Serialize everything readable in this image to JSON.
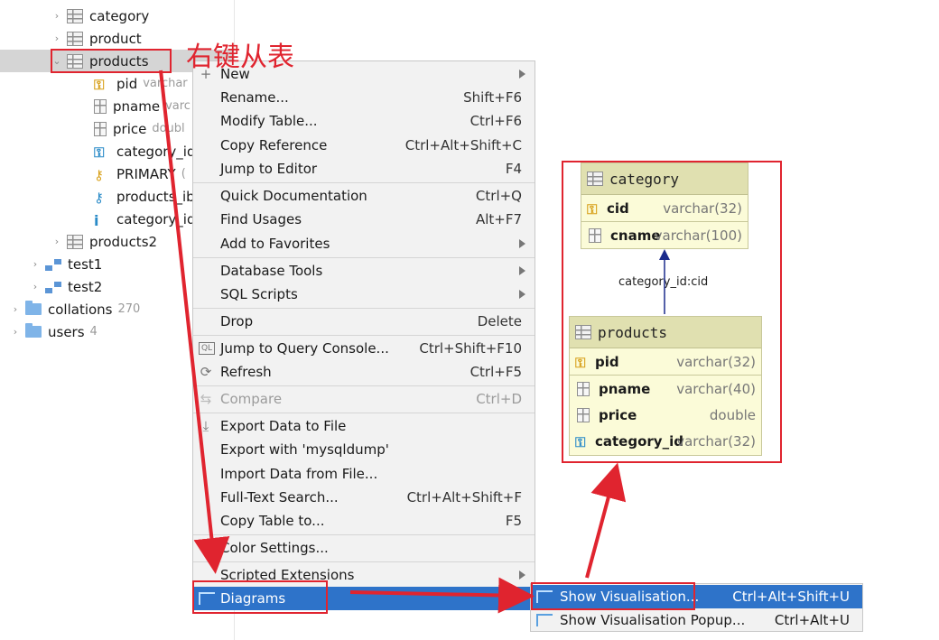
{
  "tree": {
    "items": [
      {
        "label": "category",
        "type": "table"
      },
      {
        "label": "product",
        "type": "table"
      },
      {
        "label": "products",
        "type": "table",
        "selected": true
      },
      {
        "label": "pid",
        "type": "column-pk",
        "detail": "varchar"
      },
      {
        "label": "pname",
        "type": "column",
        "detail": "varc"
      },
      {
        "label": "price",
        "type": "column",
        "detail": "doubl"
      },
      {
        "label": "category_id",
        "type": "column-fk",
        "detail": ""
      },
      {
        "label": "PRIMARY",
        "type": "key",
        "detail": "("
      },
      {
        "label": "products_ib",
        "type": "foreign-key",
        "detail": ""
      },
      {
        "label": "category_id",
        "type": "index",
        "detail": ""
      },
      {
        "label": "products2",
        "type": "table"
      },
      {
        "label": "test1",
        "type": "schema"
      },
      {
        "label": "test2",
        "type": "schema"
      },
      {
        "label": "collations",
        "type": "folder",
        "count": "270"
      },
      {
        "label": "users",
        "type": "folder",
        "count": "4"
      }
    ]
  },
  "annotation": {
    "text": "右键从表"
  },
  "menu": {
    "items": [
      {
        "label": "New",
        "shortcut": "",
        "submenu": true,
        "icon": "plus-icon"
      },
      {
        "label": "Rename...",
        "shortcut": "Shift+F6"
      },
      {
        "label": "Modify Table...",
        "shortcut": "Ctrl+F6"
      },
      {
        "label": "Copy Reference",
        "shortcut": "Ctrl+Alt+Shift+C"
      },
      {
        "label": "Jump to Editor",
        "shortcut": "F4"
      },
      {
        "label": "Quick Documentation",
        "shortcut": "Ctrl+Q"
      },
      {
        "label": "Find Usages",
        "shortcut": "Alt+F7"
      },
      {
        "label": "Add to Favorites",
        "shortcut": "",
        "submenu": true
      },
      {
        "label": "Database Tools",
        "shortcut": "",
        "submenu": true
      },
      {
        "label": "SQL Scripts",
        "shortcut": "",
        "submenu": true
      },
      {
        "label": "Drop",
        "shortcut": "Delete"
      },
      {
        "label": "Jump to Query Console...",
        "shortcut": "Ctrl+Shift+F10",
        "icon": "query-console-icon"
      },
      {
        "label": "Refresh",
        "shortcut": "Ctrl+F5",
        "icon": "refresh-icon"
      },
      {
        "label": "Compare",
        "shortcut": "Ctrl+D",
        "disabled": true,
        "icon": "compare-icon"
      },
      {
        "label": "Export Data to File",
        "shortcut": "",
        "icon": "export-icon"
      },
      {
        "label": "Export with 'mysqldump'",
        "shortcut": ""
      },
      {
        "label": "Import Data from File...",
        "shortcut": ""
      },
      {
        "label": "Full-Text Search...",
        "shortcut": "Ctrl+Alt+Shift+F"
      },
      {
        "label": "Copy Table to...",
        "shortcut": "F5"
      },
      {
        "label": "Color Settings...",
        "shortcut": ""
      },
      {
        "label": "Scripted Extensions",
        "shortcut": "",
        "submenu": true
      },
      {
        "label": "Diagrams",
        "shortcut": "",
        "highlight": true,
        "icon": "diagram-icon"
      }
    ]
  },
  "submenu": {
    "items": [
      {
        "label": "Show Visualisation...",
        "shortcut": "Ctrl+Alt+Shift+U",
        "highlight": true
      },
      {
        "label": "Show Visualisation Popup...",
        "shortcut": "Ctrl+Alt+U"
      }
    ]
  },
  "diagram": {
    "category": {
      "title": "category",
      "columns": [
        {
          "name": "cid",
          "type": "varchar(32)",
          "key": "pk"
        },
        {
          "name": "cname",
          "type": "varchar(100)",
          "key": ""
        }
      ]
    },
    "relation_label": "category_id:cid",
    "products": {
      "title": "products",
      "columns": [
        {
          "name": "pid",
          "type": "varchar(32)",
          "key": "pk"
        },
        {
          "name": "pname",
          "type": "varchar(40)",
          "key": ""
        },
        {
          "name": "price",
          "type": "double",
          "key": ""
        },
        {
          "name": "category_id",
          "type": "varchar(32)",
          "key": "fk"
        }
      ]
    }
  },
  "colors": {
    "annotation": "#e0242f",
    "highlight": "#2e73c9",
    "relation": "#1a2a8c"
  }
}
